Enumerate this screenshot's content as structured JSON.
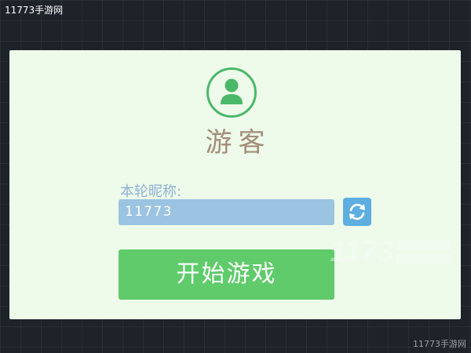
{
  "watermark": {
    "top_text": "11773手游网",
    "bottom_text": "11773手游网"
  },
  "login": {
    "avatar_icon": "user-icon",
    "title": "游客",
    "nickname_label": "本轮昵称:",
    "nickname_value": "11773",
    "refresh_icon": "refresh-icon",
    "start_button_label": "开始游戏"
  },
  "colors": {
    "accent_green": "#5fcb6a",
    "avatar_green": "#4ab869",
    "input_blue": "#9bc3e2",
    "refresh_blue": "#5eaee0",
    "title_brown": "#a18d78",
    "card_bg": "#eefaea"
  }
}
